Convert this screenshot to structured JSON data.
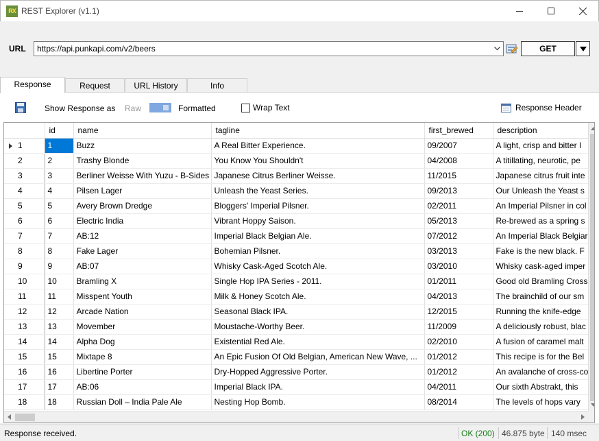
{
  "window": {
    "title": "REST Explorer  (v1.1)",
    "icon_text": "RX"
  },
  "url_bar": {
    "label": "URL",
    "value": "https://api.punkapi.com/v2/beers",
    "method": "GET"
  },
  "tabs": [
    {
      "label": "Response",
      "active": true
    },
    {
      "label": "Request",
      "active": false
    },
    {
      "label": "URL History",
      "active": false
    },
    {
      "label": "Info",
      "active": false
    }
  ],
  "options": {
    "show_label": "Show Response as",
    "raw_label": "Raw",
    "formatted_label": "Formatted",
    "wrap_label": "Wrap Text",
    "wrap_checked": false,
    "header_label": "Response Header",
    "toggle_state": "Formatted"
  },
  "table": {
    "columns": [
      "id",
      "name",
      "tagline",
      "first_brewed",
      "description"
    ],
    "selected_row": 1,
    "rows": [
      {
        "n": "1",
        "id": "1",
        "name": "Buzz",
        "tagline": "A Real Bitter Experience.",
        "first_brewed": "09/2007",
        "description": "A light, crisp and bitter I"
      },
      {
        "n": "2",
        "id": "2",
        "name": "Trashy Blonde",
        "tagline": "You Know You Shouldn't",
        "first_brewed": "04/2008",
        "description": "A titillating, neurotic, pe"
      },
      {
        "n": "3",
        "id": "3",
        "name": "Berliner Weisse With Yuzu - B-Sides",
        "tagline": "Japanese Citrus Berliner Weisse.",
        "first_brewed": "11/2015",
        "description": "Japanese citrus fruit inte"
      },
      {
        "n": "4",
        "id": "4",
        "name": "Pilsen Lager",
        "tagline": "Unleash the Yeast Series.",
        "first_brewed": "09/2013",
        "description": "Our Unleash the Yeast s"
      },
      {
        "n": "5",
        "id": "5",
        "name": "Avery Brown Dredge",
        "tagline": "Bloggers' Imperial Pilsner.",
        "first_brewed": "02/2011",
        "description": "An Imperial Pilsner in col"
      },
      {
        "n": "6",
        "id": "6",
        "name": "Electric India",
        "tagline": "Vibrant Hoppy Saison.",
        "first_brewed": "05/2013",
        "description": "Re-brewed as a spring s"
      },
      {
        "n": "7",
        "id": "7",
        "name": "AB:12",
        "tagline": "Imperial Black Belgian Ale.",
        "first_brewed": "07/2012",
        "description": "An Imperial Black Belgiar"
      },
      {
        "n": "8",
        "id": "8",
        "name": "Fake Lager",
        "tagline": "Bohemian Pilsner.",
        "first_brewed": "03/2013",
        "description": "Fake is the new black. F"
      },
      {
        "n": "9",
        "id": "9",
        "name": "AB:07",
        "tagline": "Whisky Cask-Aged Scotch Ale.",
        "first_brewed": "03/2010",
        "description": "Whisky cask-aged imper"
      },
      {
        "n": "10",
        "id": "10",
        "name": "Bramling X",
        "tagline": "Single Hop IPA Series - 2011.",
        "first_brewed": "01/2011",
        "description": "Good old Bramling Cross"
      },
      {
        "n": "11",
        "id": "11",
        "name": "Misspent Youth",
        "tagline": "Milk & Honey Scotch Ale.",
        "first_brewed": "04/2013",
        "description": "The brainchild of our sm"
      },
      {
        "n": "12",
        "id": "12",
        "name": "Arcade Nation",
        "tagline": "Seasonal Black IPA.",
        "first_brewed": "12/2015",
        "description": "Running the knife-edge"
      },
      {
        "n": "13",
        "id": "13",
        "name": "Movember",
        "tagline": "Moustache-Worthy Beer.",
        "first_brewed": "11/2009",
        "description": "A deliciously robust, blac"
      },
      {
        "n": "14",
        "id": "14",
        "name": "Alpha Dog",
        "tagline": "Existential Red Ale.",
        "first_brewed": "02/2010",
        "description": "A fusion of caramel malt"
      },
      {
        "n": "15",
        "id": "15",
        "name": "Mixtape 8",
        "tagline": "An Epic Fusion Of Old Belgian, American New Wave, ...",
        "first_brewed": "01/2012",
        "description": "This recipe is for the Bel"
      },
      {
        "n": "16",
        "id": "16",
        "name": "Libertine Porter",
        "tagline": "Dry-Hopped Aggressive Porter.",
        "first_brewed": "01/2012",
        "description": "An avalanche of cross-co"
      },
      {
        "n": "17",
        "id": "17",
        "name": "AB:06",
        "tagline": "Imperial Black IPA.",
        "first_brewed": "04/2011",
        "description": "Our sixth Abstrakt, this"
      },
      {
        "n": "18",
        "id": "18",
        "name": "Russian Doll – India Pale Ale",
        "tagline": "Nesting Hop Bomb.",
        "first_brewed": "08/2014",
        "description": "The levels of hops vary"
      }
    ]
  },
  "status": {
    "message": "Response received.",
    "code": "OK (200)",
    "size": "46.875 byte",
    "time": "140 msec"
  },
  "colors": {
    "selection": "#0078d7",
    "toggle": "#7fa7e0",
    "ok": "#1a7a1a"
  }
}
